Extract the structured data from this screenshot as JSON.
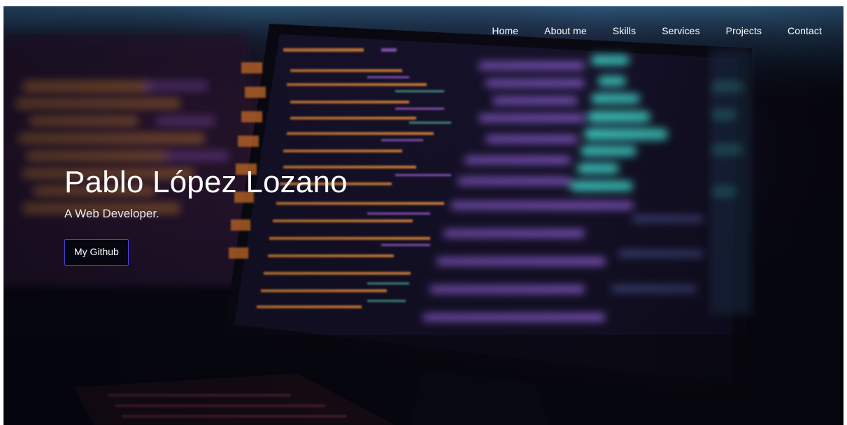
{
  "nav": {
    "items": [
      "Home",
      "About me",
      "Skills",
      "Services",
      "Projects",
      "Contact"
    ]
  },
  "hero": {
    "title": "Pablo López Lozano",
    "subtitle": "A Web Developer.",
    "cta_label": "My Github",
    "background_image": "monitor-with-code"
  },
  "colors": {
    "accent_border": "#4b43e6",
    "text": "#ffffff",
    "button_bg": "#060611"
  }
}
